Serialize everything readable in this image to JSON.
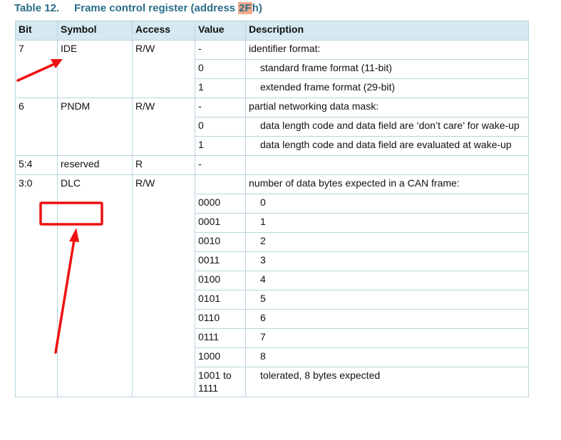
{
  "table": {
    "number": "Table 12.",
    "title_prefix": "Frame control register (address ",
    "title_address": "2F",
    "title_suffix": "h)",
    "headers": {
      "bit": "Bit",
      "symbol": "Symbol",
      "access": "Access",
      "value": "Value",
      "description": "Description"
    },
    "fields": [
      {
        "bit": "7",
        "symbol": "IDE",
        "access": "R/W",
        "value": "-",
        "description": "identifier format:",
        "values": [
          {
            "value": "0",
            "description": "standard frame format (11-bit)"
          },
          {
            "value": "1",
            "description": "extended frame format (29-bit)"
          }
        ]
      },
      {
        "bit": "6",
        "symbol": "PNDM",
        "access": "R/W",
        "value": "-",
        "description": "partial networking data mask:",
        "values": [
          {
            "value": "0",
            "description": "data length code and data field are ‘don’t care’ for wake-up"
          },
          {
            "value": "1",
            "description": "data length code and data field are evaluated at wake-up"
          }
        ]
      },
      {
        "bit": "5:4",
        "symbol": "reserved",
        "access": "R",
        "value": "-",
        "description": ""
      },
      {
        "bit": "3:0",
        "symbol": "DLC",
        "access": "R/W",
        "value": "",
        "description": "number of data bytes expected in a CAN frame:",
        "values": [
          {
            "value": "0000",
            "description": "0"
          },
          {
            "value": "0001",
            "description": "1"
          },
          {
            "value": "0010",
            "description": "2"
          },
          {
            "value": "0011",
            "description": "3"
          },
          {
            "value": "0100",
            "description": "4"
          },
          {
            "value": "0101",
            "description": "5"
          },
          {
            "value": "0110",
            "description": "6"
          },
          {
            "value": "0111",
            "description": "7"
          },
          {
            "value": "1000",
            "description": "8"
          },
          {
            "value": "1001 to 1111",
            "description": "tolerated, 8 bytes expected"
          }
        ]
      }
    ]
  },
  "annotations": {
    "color": "#ee1111"
  }
}
